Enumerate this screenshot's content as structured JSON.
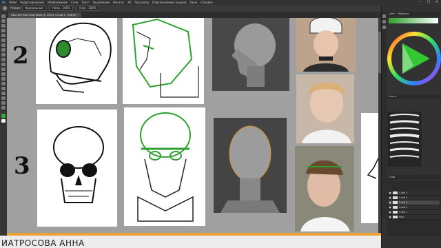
{
  "menubar": {
    "items": [
      "Файл",
      "Редактирование",
      "Изображение",
      "Слои",
      "Текст",
      "Выделение",
      "Фильтр",
      "3D",
      "Просмотр",
      "Подключаемые модули",
      "Окно",
      "Справка"
    ]
  },
  "optionsbar": {
    "label": "Режим:",
    "mode": "Нормальный",
    "opacity": "Непр.: 100%",
    "flow": "Наж.: 100%"
  },
  "window_controls": {
    "minimize": "–",
    "maximize": "□",
    "close": "✕"
  },
  "document_tab": {
    "title": "Портретный Анатомия @ 100% (Слой 1, RGB/8) *"
  },
  "canvas": {
    "numbers": {
      "row1": "2",
      "row2": "3"
    }
  },
  "footer": {
    "author_name": "ИАТРОСОВА АННА"
  },
  "right_panel": {
    "color_tab": "Цвет",
    "swatches_tab": "Образцы",
    "brushes_tab": "Кисти",
    "layers_tab": "Слои",
    "layers": [
      {
        "name": "Слой 5"
      },
      {
        "name": "Слой 4"
      },
      {
        "name": "Слой 3"
      },
      {
        "name": "Слой 2"
      },
      {
        "name": "Слой 1"
      },
      {
        "name": "Фон"
      }
    ]
  },
  "colors": {
    "accent_orange": "#f0a030",
    "fg_green": "#33aa33",
    "panel_dark": "#323232"
  }
}
